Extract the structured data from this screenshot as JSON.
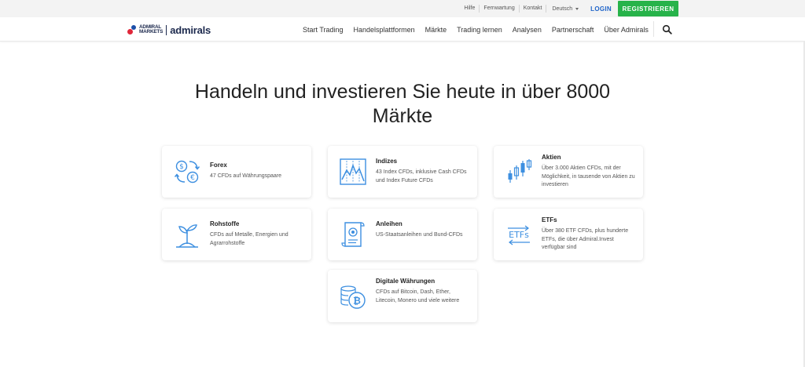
{
  "topbar": {
    "links": [
      "Hilfe",
      "Fernwartung",
      "Kontakt"
    ],
    "language": "Deutsch",
    "login": "LOGIN",
    "register": "REGISTRIEREN"
  },
  "nav": {
    "logo_line1": "ADMIRAL",
    "logo_line2": "MARKETS",
    "logo_brand": "admirals",
    "items": [
      "Start Trading",
      "Handelsplattformen",
      "Märkte",
      "Trading lernen",
      "Analysen",
      "Partnerschaft",
      "Über Admirals"
    ]
  },
  "hero": {
    "title": "Handeln und investieren Sie heute in über 8000 Märkte"
  },
  "cards": [
    {
      "icon": "currency-exchange-icon",
      "title": "Forex",
      "desc": "47 CFDs auf Währungspaare"
    },
    {
      "icon": "index-chart-icon",
      "title": "Indizes",
      "desc": "43 Index CFDs, inklusive Cash CFDs und Index Future CFDs"
    },
    {
      "icon": "candlestick-icon",
      "title": "Aktien",
      "desc": "Über 3.000 Aktien CFDs, mit der Möglichkeit, in tausende von Aktien zu investieren"
    },
    {
      "icon": "plant-icon",
      "title": "Rohstoffe",
      "desc": "CFDs auf Metalle, Energien und Agrarrohstoffe"
    },
    {
      "icon": "bond-certificate-icon",
      "title": "Anleihen",
      "desc": "US-Staatsanleihen und Bund-CFDs"
    },
    {
      "icon": "etf-icon",
      "title": "ETFs",
      "desc": "Über 380 ETF CFDs, plus hunderte ETFs, die über Admiral.Invest verfügbar sind"
    },
    {
      "icon": "bitcoin-icon",
      "title": "Digitale Währungen",
      "desc": "CFDs auf Bitcoin, Dash, Ether, Litecoin, Monero und viele weitere"
    }
  ],
  "colors": {
    "accent_blue": "#1f64c9",
    "register_green": "#27b34a",
    "icon_blue": "#3d8fe0"
  }
}
